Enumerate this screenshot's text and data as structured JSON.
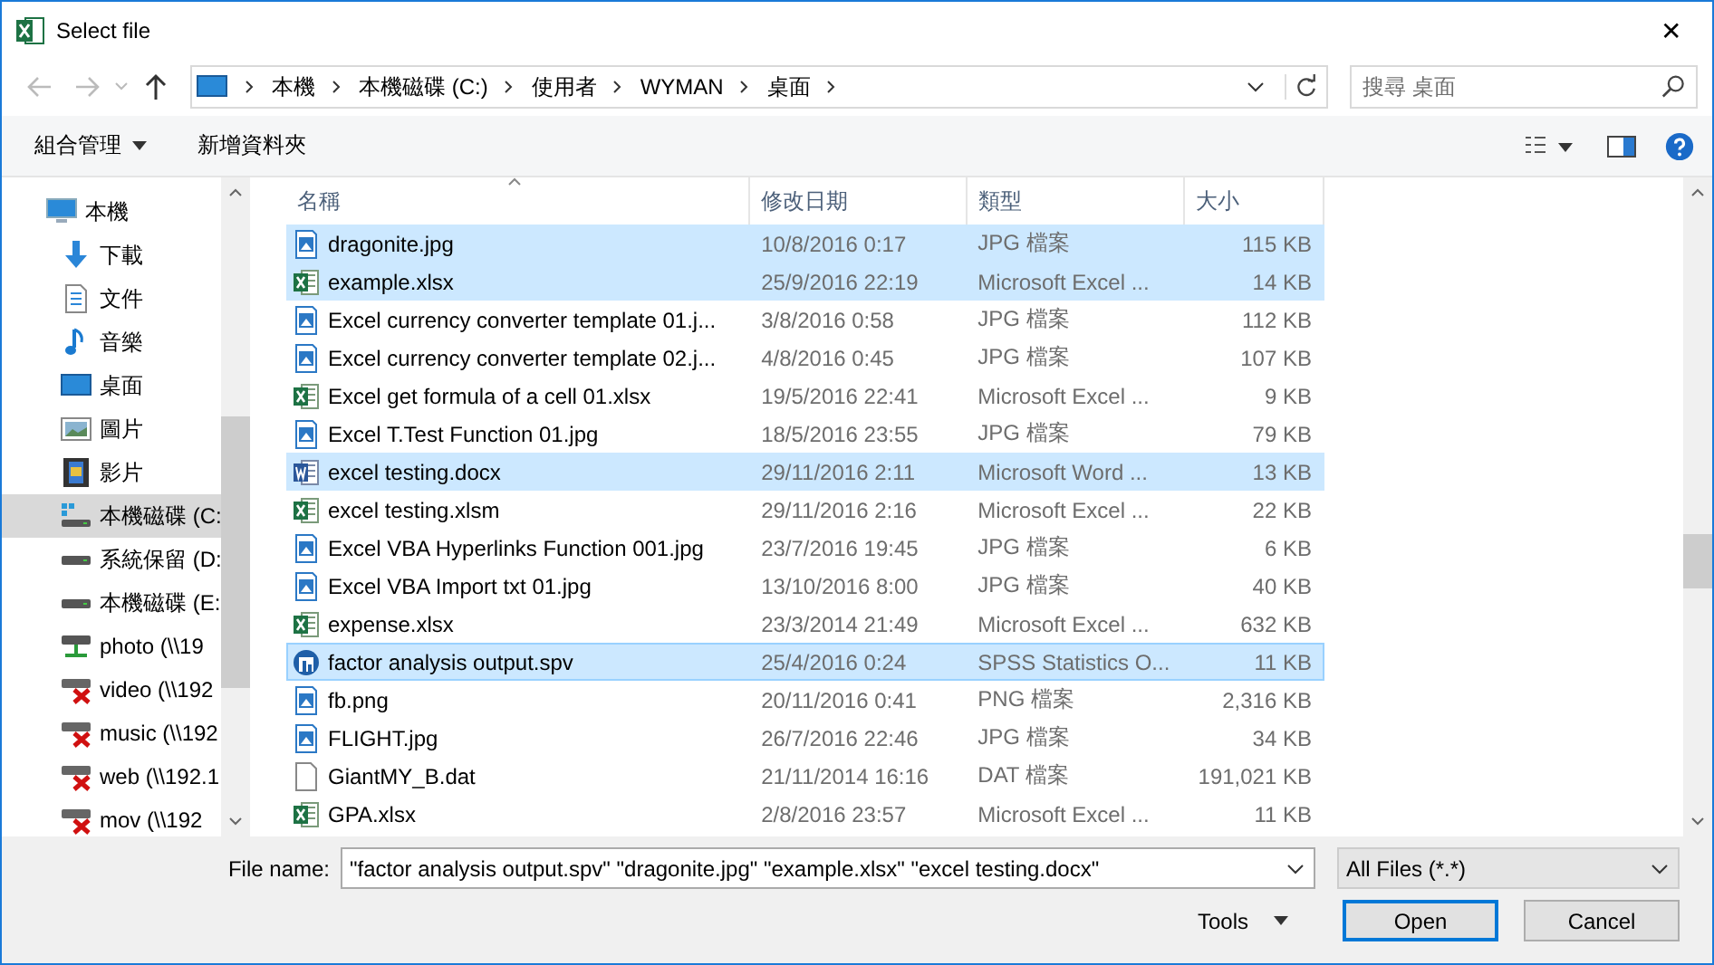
{
  "window": {
    "title": "Select file",
    "close": "✕"
  },
  "address": {
    "segments": [
      "本機",
      "本機磁碟 (C:)",
      "使用者",
      "WYMAN",
      "桌面"
    ]
  },
  "search": {
    "placeholder": "搜尋 桌面"
  },
  "toolbar": {
    "organize": "組合管理",
    "new_folder": "新增資料夾"
  },
  "sidebar": {
    "items": [
      {
        "label": "本機",
        "kind": "computer",
        "selected": false,
        "children": [
          {
            "label": "下載",
            "kind": "download",
            "selected": false
          },
          {
            "label": "文件",
            "kind": "document",
            "selected": false
          },
          {
            "label": "音樂",
            "kind": "music",
            "selected": false
          },
          {
            "label": "桌面",
            "kind": "desktop",
            "selected": false
          },
          {
            "label": "圖片",
            "kind": "pictures",
            "selected": false
          },
          {
            "label": "影片",
            "kind": "video",
            "selected": false
          },
          {
            "label": "本機磁碟 (C:",
            "kind": "system-drive",
            "selected": true
          },
          {
            "label": "系統保留 (D:",
            "kind": "drive",
            "selected": false
          },
          {
            "label": "本機磁碟 (E:",
            "kind": "drive",
            "selected": false
          },
          {
            "label": "photo (\\\\19",
            "kind": "network",
            "selected": false
          },
          {
            "label": "video (\\\\192",
            "kind": "network-off",
            "selected": false
          },
          {
            "label": "music (\\\\192",
            "kind": "network-off",
            "selected": false
          },
          {
            "label": "web (\\\\192.1",
            "kind": "network-off",
            "selected": false
          },
          {
            "label": "mov (\\\\192",
            "kind": "network-off",
            "selected": false
          }
        ]
      }
    ]
  },
  "table": {
    "columns": [
      "名稱",
      "修改日期",
      "類型",
      "大小"
    ],
    "rows": [
      {
        "name": "dragonite.jpg",
        "date": "10/8/2016 0:17",
        "type": "JPG 檔案",
        "size": "115 KB",
        "kind": "image",
        "selected": true,
        "focused": false
      },
      {
        "name": "example.xlsx",
        "date": "25/9/2016 22:19",
        "type": "Microsoft Excel ...",
        "size": "14 KB",
        "kind": "excel",
        "selected": true,
        "focused": false
      },
      {
        "name": "Excel currency converter template 01.j...",
        "date": "3/8/2016 0:58",
        "type": "JPG 檔案",
        "size": "112 KB",
        "kind": "image",
        "selected": false,
        "focused": false
      },
      {
        "name": "Excel currency converter template 02.j...",
        "date": "4/8/2016 0:45",
        "type": "JPG 檔案",
        "size": "107 KB",
        "kind": "image",
        "selected": false,
        "focused": false
      },
      {
        "name": "Excel get formula of a cell 01.xlsx",
        "date": "19/5/2016 22:41",
        "type": "Microsoft Excel ...",
        "size": "9 KB",
        "kind": "excel",
        "selected": false,
        "focused": false
      },
      {
        "name": "Excel T.Test Function 01.jpg",
        "date": "18/5/2016 23:55",
        "type": "JPG 檔案",
        "size": "79 KB",
        "kind": "image",
        "selected": false,
        "focused": false
      },
      {
        "name": "excel testing.docx",
        "date": "29/11/2016 2:11",
        "type": "Microsoft Word ...",
        "size": "13 KB",
        "kind": "word",
        "selected": true,
        "focused": false
      },
      {
        "name": "excel testing.xlsm",
        "date": "29/11/2016 2:16",
        "type": "Microsoft Excel ...",
        "size": "22 KB",
        "kind": "excel",
        "selected": false,
        "focused": false
      },
      {
        "name": "Excel VBA Hyperlinks Function 001.jpg",
        "date": "23/7/2016 19:45",
        "type": "JPG 檔案",
        "size": "6 KB",
        "kind": "image",
        "selected": false,
        "focused": false
      },
      {
        "name": "Excel VBA Import txt 01.jpg",
        "date": "13/10/2016 8:00",
        "type": "JPG 檔案",
        "size": "40 KB",
        "kind": "image",
        "selected": false,
        "focused": false
      },
      {
        "name": "expense.xlsx",
        "date": "23/3/2014 21:49",
        "type": "Microsoft Excel ...",
        "size": "632 KB",
        "kind": "excel",
        "selected": false,
        "focused": false
      },
      {
        "name": "factor analysis output.spv",
        "date": "25/4/2016 0:24",
        "type": "SPSS Statistics O...",
        "size": "11 KB",
        "kind": "spss",
        "selected": true,
        "focused": true
      },
      {
        "name": "fb.png",
        "date": "20/11/2016 0:41",
        "type": "PNG 檔案",
        "size": "2,316 KB",
        "kind": "image",
        "selected": false,
        "focused": false
      },
      {
        "name": "FLIGHT.jpg",
        "date": "26/7/2016 22:46",
        "type": "JPG 檔案",
        "size": "34 KB",
        "kind": "image",
        "selected": false,
        "focused": false
      },
      {
        "name": "GiantMY_B.dat",
        "date": "21/11/2014 16:16",
        "type": "DAT 檔案",
        "size": "191,021 KB",
        "kind": "blank",
        "selected": false,
        "focused": false
      },
      {
        "name": "GPA.xlsx",
        "date": "2/8/2016 23:57",
        "type": "Microsoft Excel ...",
        "size": "11 KB",
        "kind": "excel",
        "selected": false,
        "focused": false
      }
    ]
  },
  "file_name": {
    "label": "File name:",
    "value": "\"factor analysis output.spv\" \"dragonite.jpg\" \"example.xlsx\" \"excel testing.docx\""
  },
  "filter": {
    "value": "All Files (*.*)"
  },
  "buttons": {
    "tools": "Tools",
    "open": "Open",
    "cancel": "Cancel"
  }
}
